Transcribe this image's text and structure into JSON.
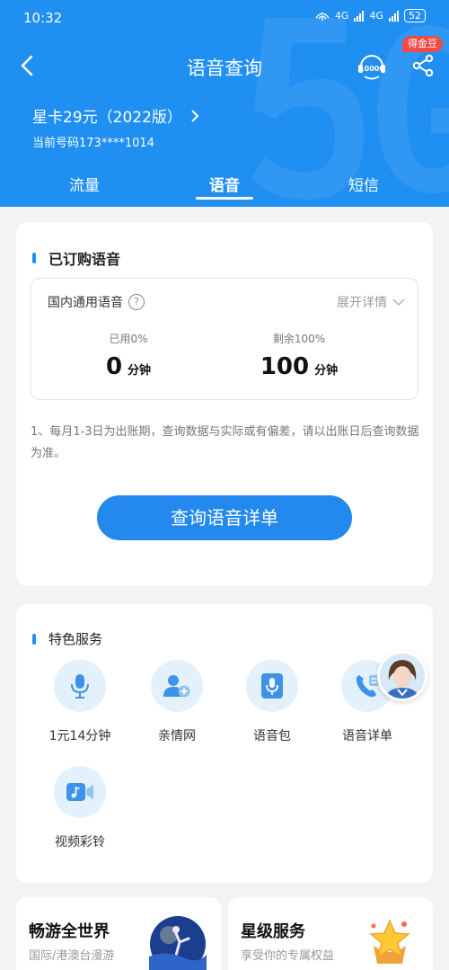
{
  "status_bar": {
    "time": "10:32",
    "net_a": "4G",
    "net_b": "4G",
    "battery": "52"
  },
  "nav": {
    "title": "语音查询",
    "badge": "得金豆"
  },
  "plan": {
    "name": "星卡29元（2022版）",
    "phone": "当前号码173****1014"
  },
  "tabs": [
    {
      "label": "流量"
    },
    {
      "label": "语音"
    },
    {
      "label": "短信"
    }
  ],
  "subscribed": {
    "title": "已订购语音",
    "item_name": "国内通用语音",
    "expand_label": "展开详情",
    "used_caption": "已用0%",
    "used_value": "0",
    "remaining_caption": "剩余100%",
    "remaining_value": "100",
    "unit": "分钟",
    "note": "1、每月1-3日为出账期，查询数据与实际或有偏差，请以出账日后查询数据为准。",
    "query_button": "查询语音详单"
  },
  "services": {
    "title": "特色服务",
    "items": [
      {
        "label": "1元14分钟",
        "icon": "microphone-icon"
      },
      {
        "label": "亲情网",
        "icon": "add-user-icon"
      },
      {
        "label": "语音包",
        "icon": "mic-package-icon"
      },
      {
        "label": "语音详单",
        "icon": "phone-detail-icon"
      },
      {
        "label": "视频彩铃",
        "icon": "video-ringtone-icon"
      }
    ]
  },
  "promos": [
    {
      "title": "畅游全世界",
      "subtitle": "国际/港澳台漫游"
    },
    {
      "title": "星级服务",
      "subtitle": "享受你的专属权益"
    }
  ],
  "colors": {
    "primary": "#1f8ff2",
    "button": "#2389ee",
    "badge": "#f04b47"
  }
}
